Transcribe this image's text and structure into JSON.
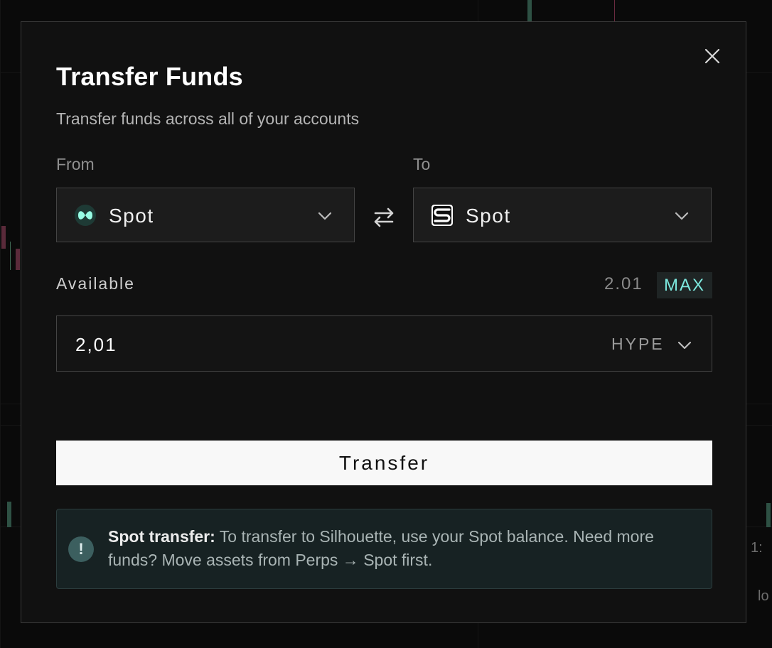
{
  "modal": {
    "title": "Transfer Funds",
    "subtitle": "Transfer funds across all of your accounts",
    "from_label": "From",
    "to_label": "To",
    "from_select": {
      "value": "Spot",
      "icon": "hyperliquid-logo-icon"
    },
    "to_select": {
      "value": "Spot",
      "icon": "silhouette-logo-icon"
    },
    "available_label": "Available",
    "available_value": "2.01",
    "max_label": "MAX",
    "amount_value": "2,01",
    "token": "HYPE",
    "transfer_label": "Transfer",
    "notice_title": "Spot transfer:",
    "notice_body": "To transfer to Silhouette, use your Spot balance. Need more funds? Move assets from Perps → Spot first."
  },
  "background": {
    "partial_texts": [
      "1:",
      "lo"
    ]
  },
  "colors": {
    "accent": "#7ce8de",
    "modal_bg": "#111111",
    "notice_bg": "#172223",
    "hyperliquid": "#97fce4",
    "silhouette_border": "#d9c9ff"
  }
}
